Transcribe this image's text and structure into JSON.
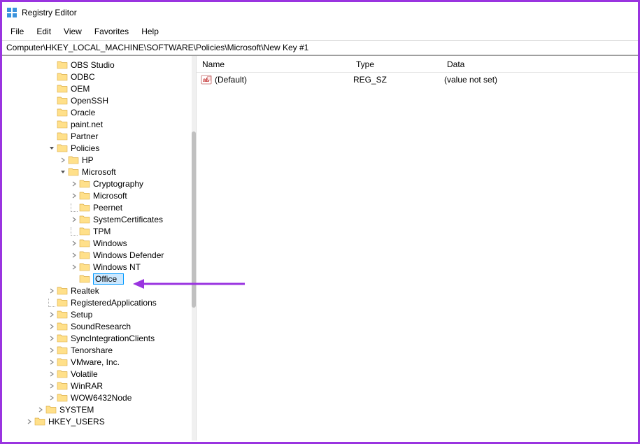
{
  "window": {
    "title": "Registry Editor"
  },
  "menu": {
    "file": "File",
    "edit": "Edit",
    "view": "View",
    "favorites": "Favorites",
    "help": "Help"
  },
  "address": "Computer\\HKEY_LOCAL_MACHINE\\SOFTWARE\\Policies\\Microsoft\\New Key #1",
  "tree": {
    "items": [
      {
        "indent": 3,
        "caret": "none",
        "label": "OBS Studio"
      },
      {
        "indent": 3,
        "caret": "none",
        "label": "ODBC"
      },
      {
        "indent": 3,
        "caret": "none",
        "label": "OEM"
      },
      {
        "indent": 3,
        "caret": "none",
        "label": "OpenSSH"
      },
      {
        "indent": 3,
        "caret": "none",
        "label": "Oracle"
      },
      {
        "indent": 3,
        "caret": "none",
        "label": "paint.net"
      },
      {
        "indent": 3,
        "caret": "none",
        "label": "Partner"
      },
      {
        "indent": 3,
        "caret": "open",
        "label": "Policies"
      },
      {
        "indent": 4,
        "caret": "closed",
        "label": "HP"
      },
      {
        "indent": 4,
        "caret": "open",
        "label": "Microsoft"
      },
      {
        "indent": 5,
        "caret": "closed",
        "label": "Cryptography"
      },
      {
        "indent": 5,
        "caret": "closed",
        "label": "Microsoft"
      },
      {
        "indent": 5,
        "caret": "leaf",
        "label": "Peernet"
      },
      {
        "indent": 5,
        "caret": "closed",
        "label": "SystemCertificates"
      },
      {
        "indent": 5,
        "caret": "leaf",
        "label": "TPM"
      },
      {
        "indent": 5,
        "caret": "closed",
        "label": "Windows"
      },
      {
        "indent": 5,
        "caret": "closed",
        "label": "Windows Defender"
      },
      {
        "indent": 5,
        "caret": "closed",
        "label": "Windows NT"
      },
      {
        "indent": 5,
        "caret": "edit",
        "label": "Office",
        "editing": true
      },
      {
        "indent": 3,
        "caret": "closed",
        "label": "Realtek"
      },
      {
        "indent": 3,
        "caret": "leaf",
        "label": "RegisteredApplications"
      },
      {
        "indent": 3,
        "caret": "closed",
        "label": "Setup"
      },
      {
        "indent": 3,
        "caret": "closed",
        "label": "SoundResearch"
      },
      {
        "indent": 3,
        "caret": "closed",
        "label": "SyncIntegrationClients"
      },
      {
        "indent": 3,
        "caret": "closed",
        "label": "Tenorshare"
      },
      {
        "indent": 3,
        "caret": "closed",
        "label": "VMware, Inc."
      },
      {
        "indent": 3,
        "caret": "closed",
        "label": "Volatile"
      },
      {
        "indent": 3,
        "caret": "closed",
        "label": "WinRAR"
      },
      {
        "indent": 3,
        "caret": "closed",
        "label": "WOW6432Node"
      },
      {
        "indent": 2,
        "caret": "closed",
        "label": "SYSTEM"
      },
      {
        "indent": 1,
        "caret": "closed",
        "label": "HKEY_USERS"
      }
    ]
  },
  "values": {
    "headers": {
      "name": "Name",
      "type": "Type",
      "data": "Data"
    },
    "rows": [
      {
        "name": "(Default)",
        "type": "REG_SZ",
        "data": "(value not set)"
      }
    ]
  },
  "editing_value": "Office"
}
